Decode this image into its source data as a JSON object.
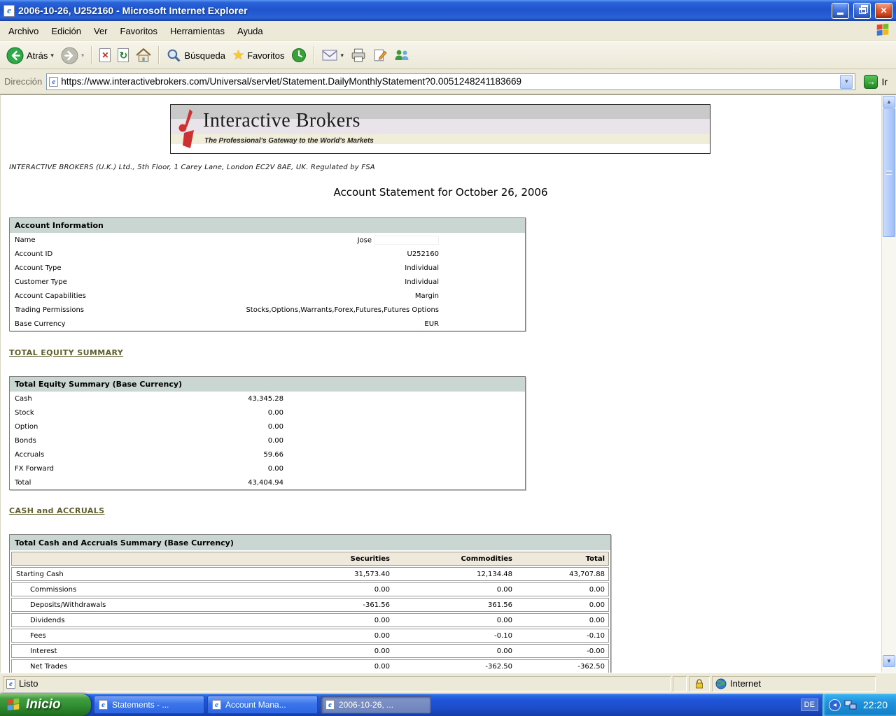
{
  "titlebar": {
    "title": "2006-10-26, U252160 - Microsoft Internet Explorer"
  },
  "menubar": {
    "items": [
      "Archivo",
      "Edición",
      "Ver",
      "Favoritos",
      "Herramientas",
      "Ayuda"
    ]
  },
  "toolbar": {
    "back_label": "Atrás",
    "search_label": "Búsqueda",
    "favorites_label": "Favoritos"
  },
  "addressbar": {
    "label": "Dirección",
    "url": "https://www.interactivebrokers.com/Universal/servlet/Statement.DailyMonthlyStatement?0.0051248241183669",
    "go_label": "Ir"
  },
  "statusbar": {
    "status": "Listo",
    "zone": "Internet"
  },
  "taskbar": {
    "start_label": "Inicio",
    "tasks": [
      {
        "label": "Statements - ..."
      },
      {
        "label": "Account Mana..."
      },
      {
        "label": "2006-10-26, ..."
      }
    ],
    "tray": {
      "language": "DE",
      "time": "22:20"
    }
  },
  "page": {
    "brand_name": "Interactive Brokers",
    "brand_tagline": "The Professional's Gateway to the World's Markets",
    "legal_line": "INTERACTIVE BROKERS (U.K.) Ltd., 5th Floor, 1 Carey Lane, London EC2V 8AE, UK. Regulated by FSA",
    "statement_title": "Account Statement for October 26, 2006",
    "account_information": {
      "header": "Account Information",
      "rows": [
        {
          "label": "Name",
          "value": "Jose"
        },
        {
          "label": "Account ID",
          "value": "U252160"
        },
        {
          "label": "Account Type",
          "value": "Individual"
        },
        {
          "label": "Customer Type",
          "value": "Individual"
        },
        {
          "label": "Account Capabilities",
          "value": "Margin"
        },
        {
          "label": "Trading Permissions",
          "value": "Stocks,Options,Warrants,Forex,Futures,Futures Options"
        },
        {
          "label": "Base Currency",
          "value": "EUR"
        }
      ]
    },
    "equity_link": "TOTAL EQUITY SUMMARY",
    "total_equity_summary": {
      "header": "Total Equity Summary (Base Currency)",
      "rows": [
        {
          "label": "Cash",
          "value": "43,345.28"
        },
        {
          "label": "Stock",
          "value": "0.00"
        },
        {
          "label": "Option",
          "value": "0.00"
        },
        {
          "label": "Bonds",
          "value": "0.00"
        },
        {
          "label": "Accruals",
          "value": "59.66"
        },
        {
          "label": "FX Forward",
          "value": "0.00"
        },
        {
          "label": "Total",
          "value": "43,404.94"
        }
      ]
    },
    "cash_link": "CASH and ACCRUALS",
    "cash_accruals_summary": {
      "header": "Total Cash and Accruals Summary (Base Currency)",
      "columns": [
        "Securities",
        "Commodities",
        "Total"
      ],
      "rows": [
        {
          "label": "Starting Cash",
          "securities": "31,573.40",
          "commodities": "12,134.48",
          "total": "43,707.88"
        },
        {
          "label": "Commissions",
          "securities": "0.00",
          "commodities": "0.00",
          "total": "0.00"
        },
        {
          "label": "Deposits/Withdrawals",
          "securities": "-361.56",
          "commodities": "361.56",
          "total": "0.00"
        },
        {
          "label": "Dividends",
          "securities": "0.00",
          "commodities": "0.00",
          "total": "0.00"
        },
        {
          "label": "Fees",
          "securities": "0.00",
          "commodities": "-0.10",
          "total": "-0.10"
        },
        {
          "label": "Interest",
          "securities": "0.00",
          "commodities": "0.00",
          "total": "-0.00"
        },
        {
          "label": "Net Trades",
          "securities": "0.00",
          "commodities": "-362.50",
          "total": "-362.50"
        }
      ]
    }
  },
  "icons": {
    "ie_e": "e",
    "dropdown_caret": "▾",
    "close_glyph": "✕",
    "stop_glyph": "✕",
    "refresh_glyph": "↻",
    "star": "★",
    "scroll_up": "▲",
    "scroll_down": "▼",
    "go_arrow": "→",
    "tray_chevron": "◂"
  },
  "colors": {
    "link": "#5f5f2d",
    "table_header_bg": "#c9d6d2",
    "table_subheader_bg": "#eee9da",
    "titlebar_blue": "#2a63d8",
    "taskbar_blue": "#1f53d8",
    "tray_blue": "#1e92dd",
    "start_green": "#2f8b2f",
    "brand_red": "#cc3232"
  }
}
